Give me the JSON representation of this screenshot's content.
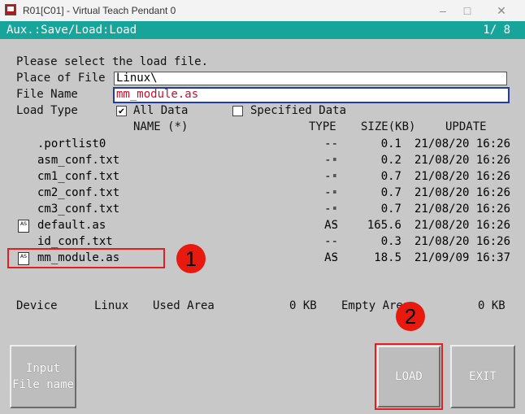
{
  "window": {
    "title": "R01[C01] - Virtual Teach Pendant 0",
    "controls": [
      "minimize-icon",
      "maximize-icon",
      "close-icon"
    ]
  },
  "header": {
    "path": "Aux.:Save/Load:Load",
    "page": "1/  8"
  },
  "form": {
    "prompt": "Please select the load file.",
    "place_label": "Place of File",
    "place_value": "Linux\\",
    "file_label": "File Name",
    "file_value": "mm_module.as",
    "type_label": "Load Type",
    "option_all": "All Data",
    "option_all_checked": true,
    "option_specified": "Specified Data",
    "option_specified_checked": false
  },
  "table": {
    "headers": {
      "name": "NAME  (*)",
      "type": "TYPE",
      "size": "SIZE(KB)",
      "update": "UPDATE"
    },
    "rows": [
      {
        "name": ".portlist0",
        "type": "---",
        "size": "0.1",
        "update": "21/08/20 16:26",
        "icon": ""
      },
      {
        "name": "asm_conf.txt",
        "type": "---",
        "size": "0.2",
        "update": "21/08/20 16:26",
        "icon": ""
      },
      {
        "name": "cm1_conf.txt",
        "type": "---",
        "size": "0.7",
        "update": "21/08/20 16:26",
        "icon": ""
      },
      {
        "name": "cm2_conf.txt",
        "type": "---",
        "size": "0.7",
        "update": "21/08/20 16:26",
        "icon": ""
      },
      {
        "name": "cm3_conf.txt",
        "type": "---",
        "size": "0.7",
        "update": "21/08/20 16:26",
        "icon": ""
      },
      {
        "name": "default.as",
        "type": "AS",
        "size": "165.6",
        "update": "21/08/20 16:26",
        "icon": "AS"
      },
      {
        "name": "id_conf.txt",
        "type": "---",
        "size": "0.3",
        "update": "21/08/20 16:26",
        "icon": ""
      },
      {
        "name": "mm_module.as",
        "type": "AS",
        "size": "18.5",
        "update": "21/09/09 16:37",
        "icon": "AS"
      }
    ]
  },
  "status": {
    "device_label": "Device",
    "device_value": "Linux",
    "used_label": "Used Area",
    "used_value": "0 KB",
    "empty_label": "Empty Area",
    "empty_value": "0 KB"
  },
  "annotations": {
    "step1": "1",
    "step2": "2"
  },
  "buttons": {
    "input_line1": "Input",
    "input_line2": "File name",
    "load": "LOAD",
    "exit": "EXIT"
  },
  "colors": {
    "header_bg": "#17a49a",
    "panel_bg": "#c8c8c8",
    "highlight": "#e02020",
    "badge": "#e81a0f"
  }
}
